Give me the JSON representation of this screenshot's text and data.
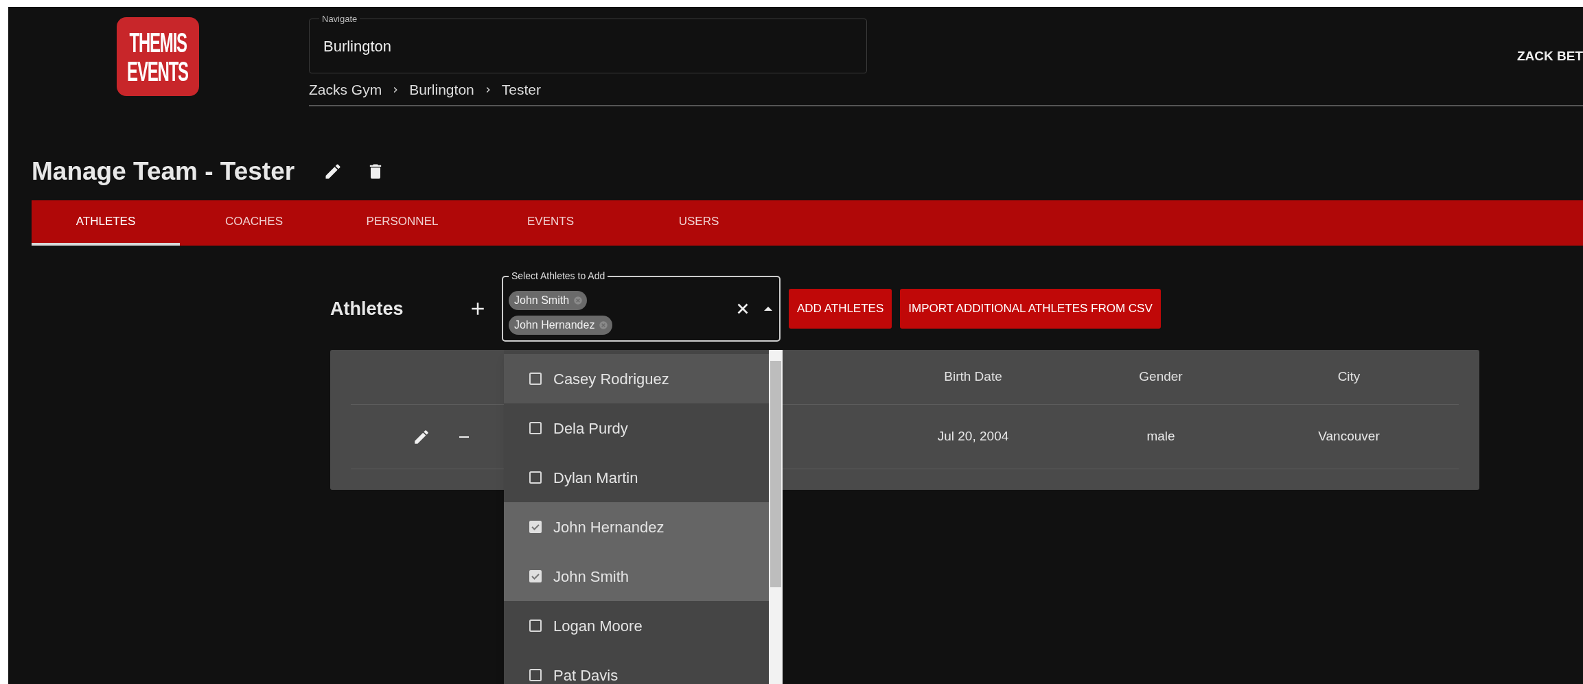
{
  "logo": {
    "lines": [
      "THEMIS",
      "EVENTS"
    ]
  },
  "navigate": {
    "label": "Navigate",
    "value": "Burlington"
  },
  "breadcrumb": [
    "Zacks Gym",
    "Burlington",
    "Tester"
  ],
  "user": {
    "name": "ZACK BET"
  },
  "page_title": "Manage Team - Tester",
  "tabs": [
    {
      "label": "ATHLETES",
      "selected": true
    },
    {
      "label": "COACHES",
      "selected": false
    },
    {
      "label": "PERSONNEL",
      "selected": false
    },
    {
      "label": "EVENTS",
      "selected": false
    },
    {
      "label": "USERS",
      "selected": false
    }
  ],
  "section": {
    "title": "Athletes"
  },
  "athlete_select": {
    "label": "Select Athletes to Add",
    "chips": [
      "John Smith",
      "John Hernandez"
    ],
    "expanded": true
  },
  "buttons": [
    "ADD ATHLETES",
    "IMPORT ADDITIONAL ATHLETES FROM CSV"
  ],
  "table": {
    "columns": [
      "Birth Date",
      "Gender",
      "City"
    ],
    "rows": [
      {
        "cells": [
          "Jul 20, 2004",
          "male",
          "Vancouver"
        ]
      }
    ]
  },
  "options": [
    {
      "label": "Casey Rodriguez",
      "checked": false,
      "hovered": true
    },
    {
      "label": "Dela Purdy",
      "checked": false,
      "hovered": false
    },
    {
      "label": "Dylan Martin",
      "checked": false,
      "hovered": false
    },
    {
      "label": "John Hernandez",
      "checked": true,
      "hovered": false
    },
    {
      "label": "John Smith",
      "checked": true,
      "hovered": false
    },
    {
      "label": "Logan Moore",
      "checked": false,
      "hovered": false
    },
    {
      "label": "Pat Davis",
      "checked": false,
      "hovered": false
    }
  ]
}
